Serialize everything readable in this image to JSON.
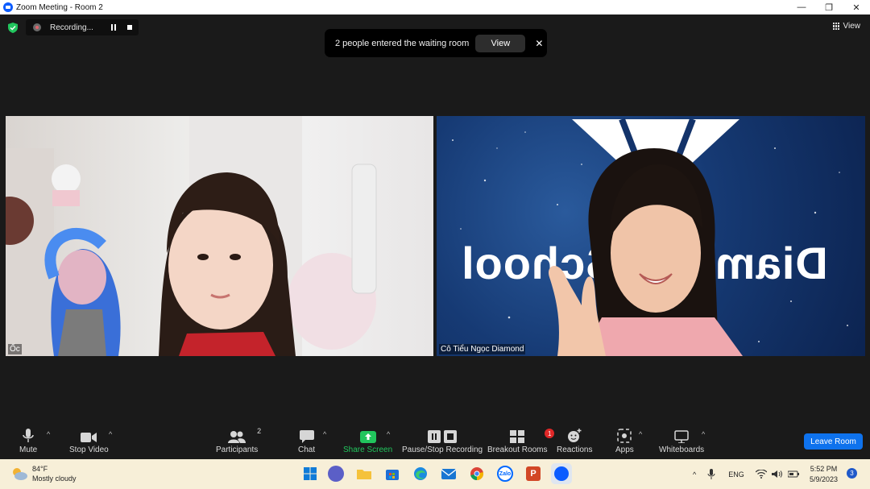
{
  "window": {
    "title": "Zoom Meeting - Room 2",
    "controls": [
      "—",
      "❐",
      "✕"
    ]
  },
  "top": {
    "recording_label": "Recording...",
    "view_label": "View",
    "notification": {
      "text": "2 people entered the waiting room",
      "button": "View",
      "close": "✕"
    }
  },
  "video": {
    "tile1": {
      "name": "Ốc"
    },
    "tile2": {
      "name": "Cô Tiểu Ngọc Diamond",
      "background_text": "Diamond School"
    }
  },
  "toolbar": {
    "mute": "Mute",
    "stop_video": "Stop Video",
    "participants": "Participants",
    "participants_count": "2",
    "chat": "Chat",
    "share_screen": "Share Screen",
    "pause_stop_recording": "Pause/Stop Recording",
    "breakout_rooms": "Breakout Rooms",
    "breakout_badge": "1",
    "reactions": "Reactions",
    "apps": "Apps",
    "whiteboards": "Whiteboards",
    "leave": "Leave Room",
    "accent_color": "#0e72ed",
    "share_color": "#21c55d"
  },
  "taskbar": {
    "weather_temp": "84°F",
    "weather_desc": "Mostly cloudy",
    "apps": [
      "windows-start",
      "teams",
      "file-explorer",
      "store",
      "edge",
      "mail",
      "chrome",
      "zalo",
      "powerpoint",
      "zoom"
    ],
    "zalo_label": "Zalo",
    "language": "ENG",
    "time": "5:52 PM",
    "date": "5/9/2023",
    "notifications": "3"
  }
}
